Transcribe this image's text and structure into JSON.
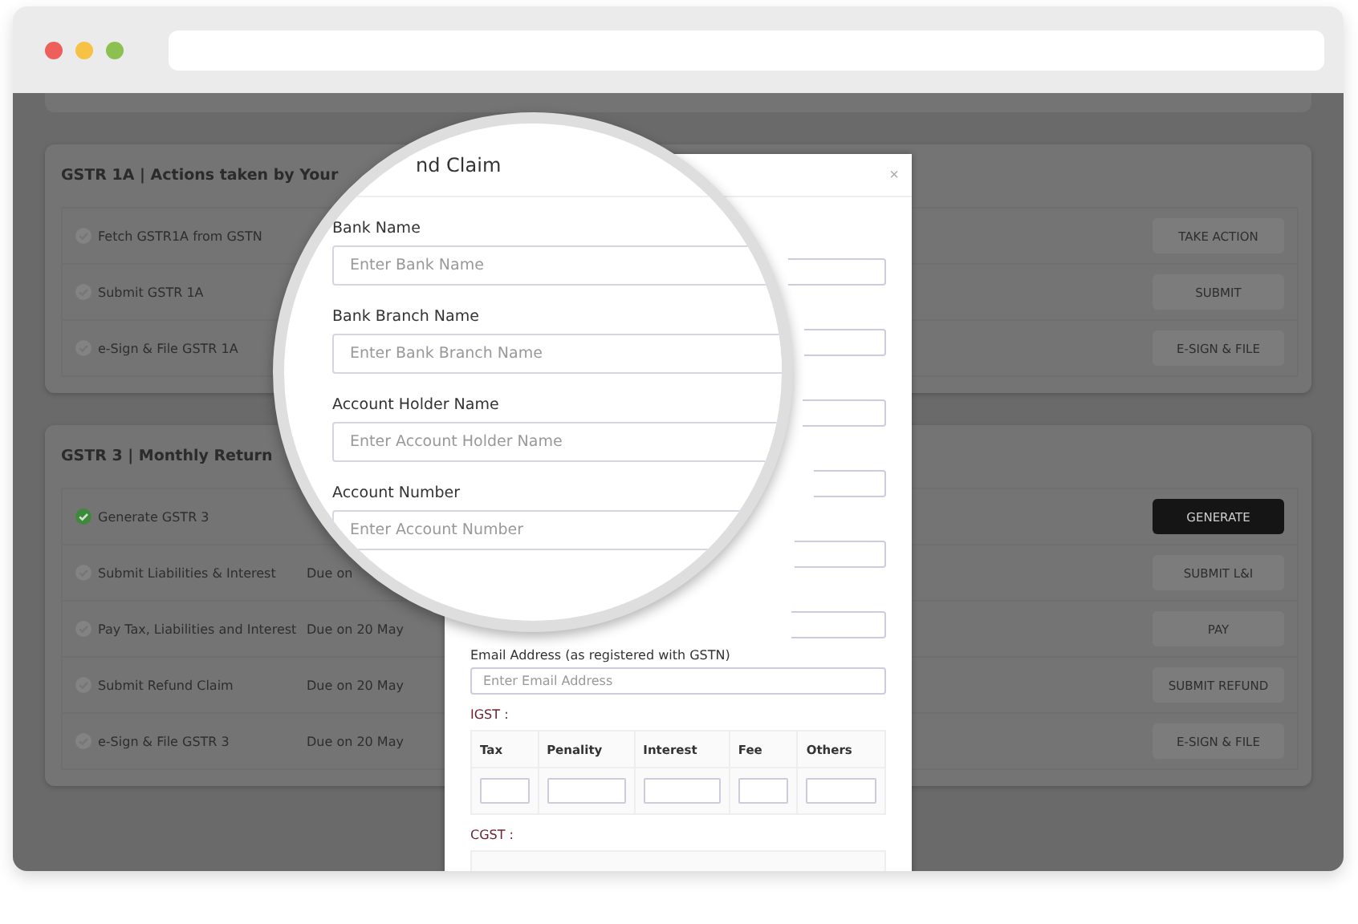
{
  "cards": [
    {
      "title": "GSTR 1A | Actions taken by Your",
      "steps": [
        {
          "label": "Fetch GSTR1A from GSTN",
          "done": false,
          "button": {
            "label": "TAKE ACTION",
            "primary": false
          }
        },
        {
          "label": "Submit GSTR 1A",
          "done": false,
          "button": {
            "label": "SUBMIT",
            "primary": false
          }
        },
        {
          "label": "e-Sign & File GSTR 1A",
          "done": false,
          "button": {
            "label": "E-SIGN & FILE",
            "primary": false
          }
        }
      ]
    },
    {
      "title": "GSTR 3 | Monthly Return",
      "steps": [
        {
          "label": "Generate GSTR 3",
          "done": true,
          "button": {
            "label": "GENERATE",
            "primary": true
          }
        },
        {
          "label": "Submit Liabilities & Interest",
          "done": false,
          "due": "Due on",
          "button": {
            "label": "SUBMIT L&I",
            "primary": false
          }
        },
        {
          "label": "Pay Tax, Liabilities and Interest",
          "done": false,
          "due": "Due on 20 May",
          "button": {
            "label": "PAY",
            "primary": false
          }
        },
        {
          "label": "Submit Refund Claim",
          "done": false,
          "due": "Due on 20 May",
          "button": {
            "label": "SUBMIT REFUND",
            "primary": false
          }
        },
        {
          "label": "e-Sign & File GSTR 3",
          "done": false,
          "due": "Due on 20 May",
          "button": {
            "label": "E-SIGN & FILE",
            "primary": false
          }
        }
      ]
    }
  ],
  "modal": {
    "close": "×",
    "email": {
      "label": "Email Address (as registered with GSTN)",
      "placeholder": "Enter Email Address"
    },
    "sections": [
      {
        "label": "IGST :",
        "columns": [
          "Tax",
          "Penality",
          "Interest",
          "Fee",
          "Others"
        ]
      },
      {
        "label": "CGST :"
      }
    ]
  },
  "magnifier": {
    "title": "nd Claim",
    "fields": [
      {
        "label": "Bank Name",
        "placeholder": "Enter Bank Name"
      },
      {
        "label": "Bank Branch Name",
        "placeholder": "Enter Bank Branch Name"
      },
      {
        "label": "Account Holder Name",
        "placeholder": "Enter Account Holder Name"
      },
      {
        "label": "Account Number",
        "placeholder": "Enter Account Number"
      }
    ]
  }
}
